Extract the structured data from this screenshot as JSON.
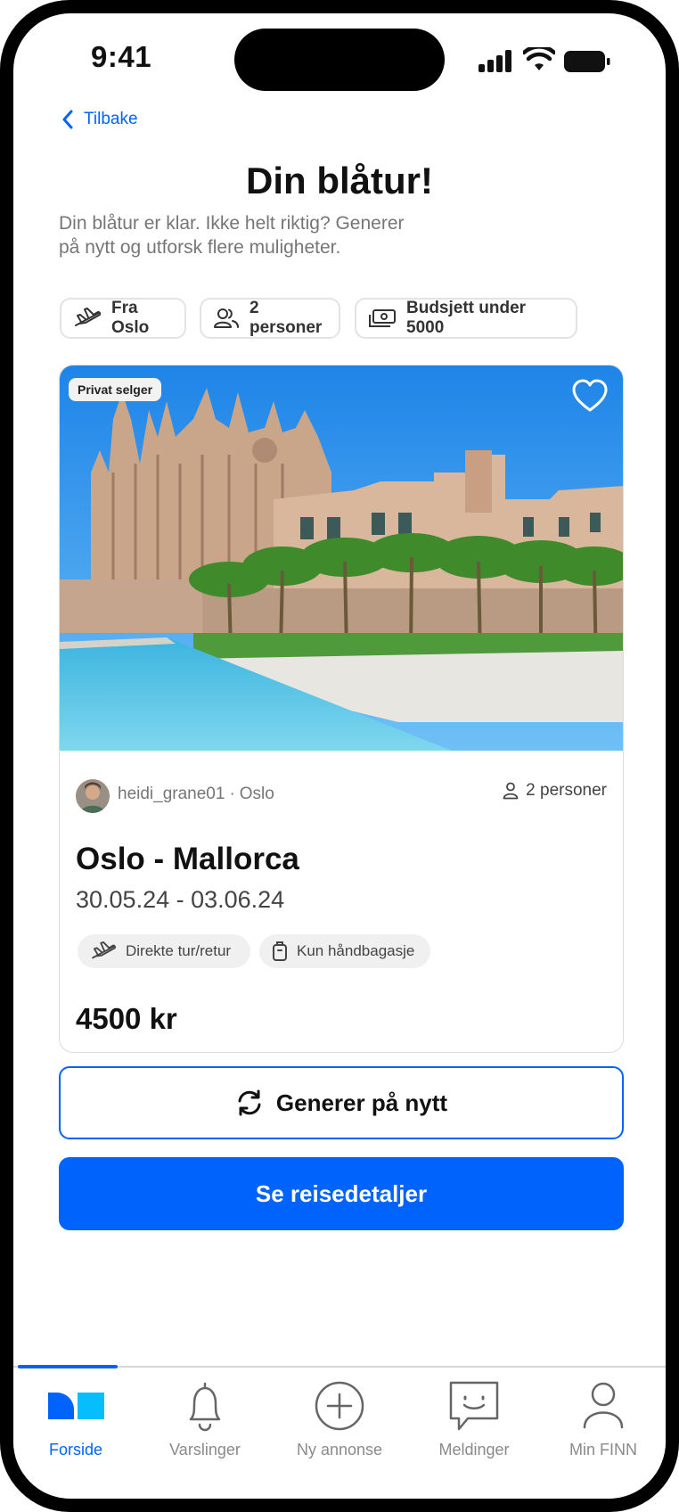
{
  "status_bar": {
    "time": "9:41"
  },
  "header": {
    "back_label": "Tilbake",
    "title": "Din blåtur!",
    "subtitle_line1": "Din blåtur er klar. Ikke helt riktig? Generer",
    "subtitle_line2": "på nytt og utforsk flere muligheter."
  },
  "filters": [
    {
      "label": "Fra Oslo",
      "icon": "plane-icon"
    },
    {
      "label": "2 personer",
      "icon": "people-icon"
    },
    {
      "label": "Budsjett under 5000",
      "icon": "money-icon"
    }
  ],
  "card": {
    "badge": "Privat selger",
    "seller_name": "heidi_grane01",
    "seller_sep": "·",
    "seller_city": "Oslo",
    "persons": "2 personer",
    "route": "Oslo - Mallorca",
    "dates": "30.05.24 - 03.06.24",
    "tags": [
      {
        "label": "Direkte tur/retur",
        "icon": "plane-icon"
      },
      {
        "label": "Kun håndbagasje",
        "icon": "luggage-icon"
      }
    ],
    "price": "4500 kr"
  },
  "actions": {
    "regenerate_label": "Generer på nytt",
    "details_label": "Se reisedetaljer"
  },
  "tabbar": {
    "items": [
      {
        "label": "Forside",
        "icon": "finn-logo-icon",
        "active": true
      },
      {
        "label": "Varslinger",
        "icon": "bell-icon"
      },
      {
        "label": "Ny annonse",
        "icon": "plus-circle-icon"
      },
      {
        "label": "Meldinger",
        "icon": "chat-icon"
      },
      {
        "label": "Min FINN",
        "icon": "person-icon"
      }
    ]
  },
  "colors": {
    "accent": "#0063fb",
    "text": "#111111",
    "muted": "#767676"
  }
}
